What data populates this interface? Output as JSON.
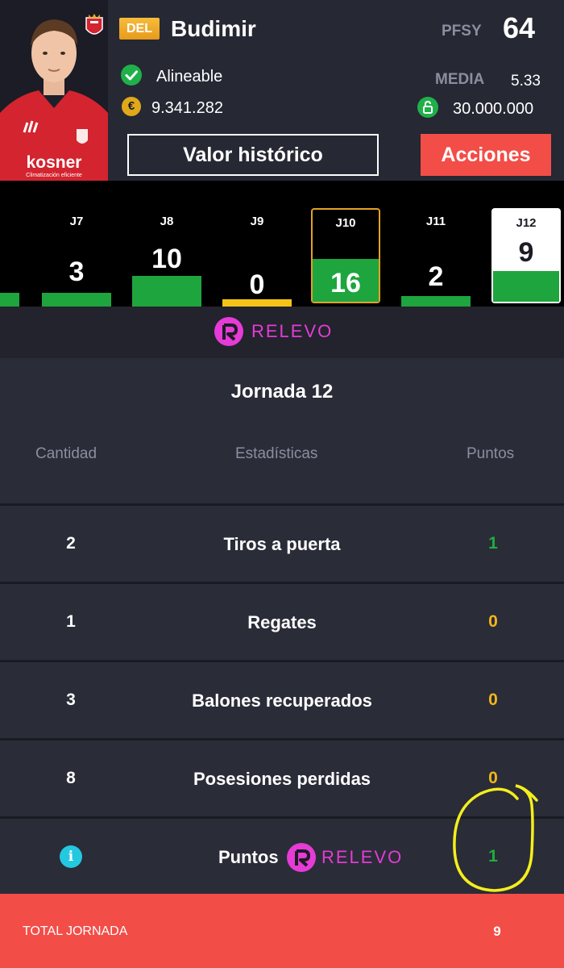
{
  "player": {
    "position": "DEL",
    "name": "Budimir",
    "pfsy_label": "PFSY",
    "pfsy_value": "64",
    "status": "Alineable",
    "media_label": "MEDIA",
    "media_value": "5.33",
    "market_value": "9.341.282",
    "clause_value": "30.000.000",
    "shirt_sponsor": "kosner",
    "shirt_sub": "Climatización eficiente"
  },
  "buttons": {
    "history": "Valor histórico",
    "actions": "Acciones"
  },
  "matches": [
    {
      "label": "",
      "points": "",
      "bar_color": "#1ea53e",
      "bar_level": 0.14
    },
    {
      "label": "J7",
      "points": "3",
      "bar_color": "#1ea53e",
      "bar_level": 0.14
    },
    {
      "label": "J8",
      "points": "10",
      "bar_color": "#1ea53e",
      "bar_level": 0.32
    },
    {
      "label": "J9",
      "points": "0",
      "bar_color": "#f2c418",
      "bar_level": 0.08
    },
    {
      "label": "J10",
      "points": "16",
      "bar_color": "#1ea53e",
      "bar_level": 0.45
    },
    {
      "label": "J11",
      "points": "2",
      "bar_color": "#1ea53e",
      "bar_level": 0.11
    },
    {
      "label": "J12",
      "points": "9",
      "bar_color": "#1ea53e",
      "bar_level": 0.32
    }
  ],
  "sponsor": {
    "word": "RELEVO"
  },
  "stats": {
    "title": "Jornada 12",
    "headers": {
      "qty": "Cantidad",
      "stat": "Estadísticas",
      "pts": "Puntos"
    },
    "rows": [
      {
        "qty": "2",
        "stat": "Tiros a puerta",
        "pts": "1",
        "pts_color": "#1fae3e"
      },
      {
        "qty": "1",
        "stat": "Regates",
        "pts": "0",
        "pts_color": "#f2b51a"
      },
      {
        "qty": "3",
        "stat": "Balones recuperados",
        "pts": "0",
        "pts_color": "#f2b51a"
      },
      {
        "qty": "8",
        "stat": "Posesiones perdidas",
        "pts": "0",
        "pts_color": "#f2b51a"
      }
    ],
    "relevo_row": {
      "label": "Puntos",
      "word": "RELEVO",
      "pts": "1",
      "pts_color": "#1fae3e"
    }
  },
  "total": {
    "label": "TOTAL JORNADA",
    "value": "9"
  },
  "colors": {
    "accent": "#f34d48",
    "green": "#1ea53e",
    "yellow": "#f2c418",
    "relevo": "#e63bd6"
  }
}
